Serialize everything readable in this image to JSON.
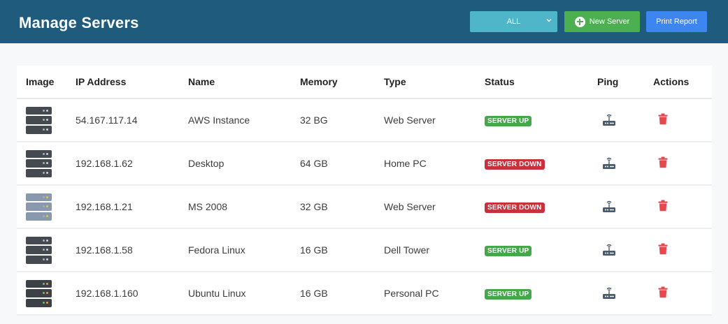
{
  "header": {
    "title": "Manage Servers",
    "filter_value": "ALL",
    "new_server_label": "New Server",
    "print_report_label": "Print Report"
  },
  "colors": {
    "header_bg": "#1f5b7d",
    "filter_bg": "#4fb6c9",
    "new_button_bg": "#4caf50",
    "print_button_bg": "#3d86f0",
    "status_up": "#44a84b",
    "status_down": "#c8303c",
    "delete_icon": "#e5484d"
  },
  "table": {
    "columns": [
      "Image",
      "IP Address",
      "Name",
      "Memory",
      "Type",
      "Status",
      "Ping",
      "Actions"
    ],
    "rows": [
      {
        "icon": "server-rack-icon",
        "ip": "54.167.117.14",
        "name": "AWS Instance",
        "memory": "32 BG",
        "type": "Web Server",
        "status": "SERVER UP",
        "status_kind": "up"
      },
      {
        "icon": "server-rack-icon",
        "ip": "192.168.1.62",
        "name": "Desktop",
        "memory": "64 GB",
        "type": "Home PC",
        "status": "SERVER DOWN",
        "status_kind": "down"
      },
      {
        "icon": "server-rack-icon",
        "ip": "192.168.1.21",
        "name": "MS 2008",
        "memory": "32 GB",
        "type": "Web Server",
        "status": "SERVER DOWN",
        "status_kind": "down"
      },
      {
        "icon": "server-rack-icon",
        "ip": "192.168.1.58",
        "name": "Fedora Linux",
        "memory": "16 GB",
        "type": "Dell Tower",
        "status": "SERVER UP",
        "status_kind": "up"
      },
      {
        "icon": "server-rack-icon",
        "ip": "192.168.1.160",
        "name": "Ubuntu Linux",
        "memory": "16 GB",
        "type": "Personal PC",
        "status": "SERVER UP",
        "status_kind": "up"
      }
    ]
  }
}
